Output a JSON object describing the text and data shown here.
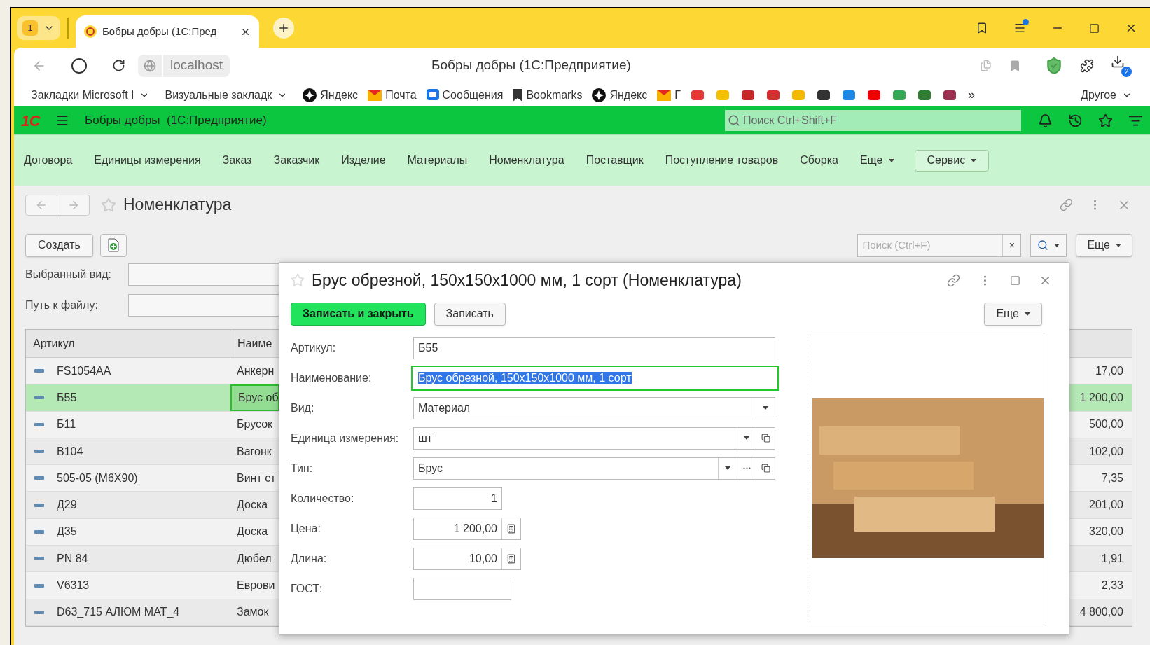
{
  "browser": {
    "tab_count": "1",
    "tab_title": "Бобры добры (1С:Пред",
    "address": "localhost",
    "page_title": "Бобры добры (1С:Предприятие)",
    "download_count": "2",
    "bookmarks": [
      {
        "kind": "folder",
        "label": "Закладки Microsoft I"
      },
      {
        "kind": "folder",
        "label": "Визуальные закладк"
      },
      {
        "kind": "link",
        "label": "Яндекс"
      },
      {
        "kind": "link",
        "label": "Почта"
      },
      {
        "kind": "link",
        "label": "Сообщения"
      },
      {
        "kind": "link",
        "label": "Bookmarks"
      },
      {
        "kind": "link",
        "label": "Яндекс"
      },
      {
        "kind": "link",
        "label": "Г"
      }
    ],
    "bookmarks_more": "»",
    "other_folder": "Другое"
  },
  "app": {
    "logo": "1С",
    "title": "Бобры добры  (1С:Предприятие)",
    "search_placeholder": "Поиск Ctrl+Shift+F"
  },
  "sections": [
    {
      "label": "Договора"
    },
    {
      "label": "Единицы измерения"
    },
    {
      "label": "Заказ"
    },
    {
      "label": "Заказчик"
    },
    {
      "label": "Изделие"
    },
    {
      "label": "Материалы"
    },
    {
      "label": "Номенклатура"
    },
    {
      "label": "Поставщик"
    },
    {
      "label": "Поступление товаров"
    },
    {
      "label": "Сборка"
    }
  ],
  "sections_more": "Еще",
  "service_button": "Сервис",
  "page": {
    "title": "Номенклатура",
    "create_button": "Создать",
    "search_placeholder": "Поиск (Ctrl+F)",
    "clear": "×",
    "more_button": "Еще",
    "filters": [
      {
        "label": "Выбранный вид:"
      },
      {
        "label": "Путь к файлу:"
      }
    ]
  },
  "table": {
    "columns": [
      "Артикул",
      "Наиме"
    ],
    "rows": [
      {
        "article": "FS1054AA",
        "name": "Анкерн",
        "price": "17,00",
        "selected": false
      },
      {
        "article": "Б55",
        "name": "Брус об",
        "price": "1 200,00",
        "selected": true
      },
      {
        "article": "Б11",
        "name": "Брусок",
        "price": "500,00",
        "selected": false
      },
      {
        "article": "В104",
        "name": "Вагонк",
        "price": "102,00",
        "selected": false
      },
      {
        "article": "505-05 (М6Х90)",
        "name": "Винт ст",
        "price": "7,35",
        "selected": false
      },
      {
        "article": "Д29",
        "name": "Доска",
        "price": "201,00",
        "selected": false
      },
      {
        "article": "Д35",
        "name": "Доска",
        "price": "320,00",
        "selected": false
      },
      {
        "article": "PN 84",
        "name": "Дюбел",
        "price": "1,91",
        "selected": false
      },
      {
        "article": "V6313",
        "name": "Еврови",
        "price": "2,33",
        "selected": false
      },
      {
        "article": "D63_715 АЛЮМ МАТ_4",
        "name": "Замок",
        "price": "4 800,00",
        "selected": false
      }
    ]
  },
  "dialog": {
    "title": "Брус обрезной, 150x150x1000 мм, 1 сорт (Номенклатура)",
    "save_close_button": "Записать и закрыть",
    "save_button": "Записать",
    "more_button": "Еще",
    "fields": [
      {
        "label": "Артикул:",
        "value": "Б55",
        "kind": "text",
        "focused": false
      },
      {
        "label": "Наименование:",
        "value": "Брус обрезной, 150x150x1000 мм, 1 сорт",
        "kind": "text",
        "focused": true
      },
      {
        "label": "Вид:",
        "value": "Материал",
        "kind": "text",
        "focused": false,
        "buttons": [
          {
            "kind": "dropdown"
          }
        ]
      },
      {
        "label": "Единица измерения:",
        "value": "шт",
        "kind": "text",
        "focused": false,
        "buttons": [
          {
            "kind": "dropdown"
          },
          {
            "kind": "open"
          }
        ]
      },
      {
        "label": "Тип:",
        "value": "Брус",
        "kind": "text",
        "focused": false,
        "buttons": [
          {
            "kind": "dropdown"
          },
          {
            "kind": "choose"
          },
          {
            "kind": "open"
          }
        ]
      },
      {
        "label": "Количество:",
        "value": "1",
        "kind": "number",
        "focused": false
      },
      {
        "label": "Цена:",
        "value": "1 200,00",
        "kind": "number",
        "focused": false,
        "buttons": [
          {
            "kind": "calculator"
          }
        ]
      },
      {
        "label": "Длина:",
        "value": "10,00",
        "kind": "number",
        "focused": false,
        "buttons": [
          {
            "kind": "calculator"
          }
        ]
      },
      {
        "label": "ГОСТ:",
        "kind": "short",
        "focused": false
      }
    ]
  }
}
